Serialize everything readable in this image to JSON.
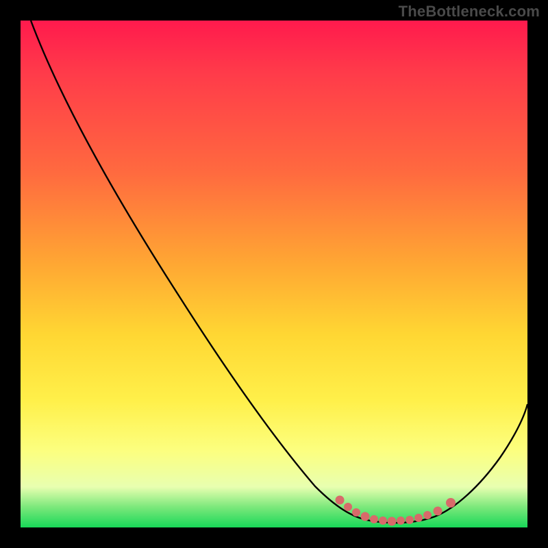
{
  "watermark": "TheBottleneck.com",
  "chart_data": {
    "type": "line",
    "title": "",
    "xlabel": "",
    "ylabel": "",
    "xlim": [
      0,
      100
    ],
    "ylim": [
      0,
      100
    ],
    "grid": false,
    "series": [
      {
        "name": "bottleneck-curve",
        "x": [
          2,
          10,
          20,
          30,
          40,
          50,
          60,
          65,
          70,
          75,
          80,
          85,
          90,
          100
        ],
        "values": [
          100,
          88,
          74,
          60,
          46,
          32,
          17,
          9,
          4,
          2,
          2,
          3,
          7,
          20
        ]
      }
    ],
    "optimal_range_x": [
      63,
      85
    ],
    "markers": {
      "name": "optimal-zone-dots",
      "color": "#d86a6a",
      "x": [
        63,
        66,
        69,
        72,
        74,
        76,
        78,
        80,
        82,
        85
      ],
      "values": [
        10.5,
        8,
        5.5,
        4,
        3.5,
        3,
        3,
        3,
        3.5,
        5
      ]
    }
  },
  "colors": {
    "curve_stroke": "#000000",
    "marker_fill": "#d86a6a",
    "background_black": "#000000"
  }
}
